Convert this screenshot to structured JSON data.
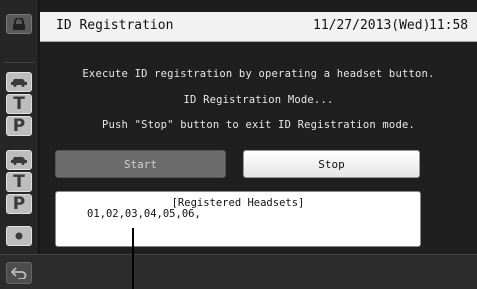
{
  "header": {
    "title": "ID Registration",
    "date": "11/27/2013(Wed)",
    "time": "11:58"
  },
  "messages": [
    "Execute ID registration by operating a headset button.",
    "ID Registration Mode...",
    "Push \"Stop\" button to exit ID Registration mode."
  ],
  "buttons": {
    "start_label": "Start",
    "stop_label": "Stop"
  },
  "registered": {
    "title": "[Registered Headsets]",
    "list": "01,02,03,04,05,06,"
  },
  "sidebar": {
    "items": [
      {
        "icon": "lock-icon"
      },
      {
        "icon": "car-icon"
      },
      {
        "label": "T"
      },
      {
        "label": "P"
      },
      {
        "icon": "car-icon"
      },
      {
        "label": "T"
      },
      {
        "label": "P"
      },
      {
        "icon": "dot-icon"
      }
    ],
    "back_icon": "back-arrow-icon"
  },
  "colors": {
    "header_bg": "#f2f2f2",
    "screen_bg": "#1c1c1c",
    "button_active": "#ffffff",
    "button_inactive": "#6b6b6b"
  }
}
